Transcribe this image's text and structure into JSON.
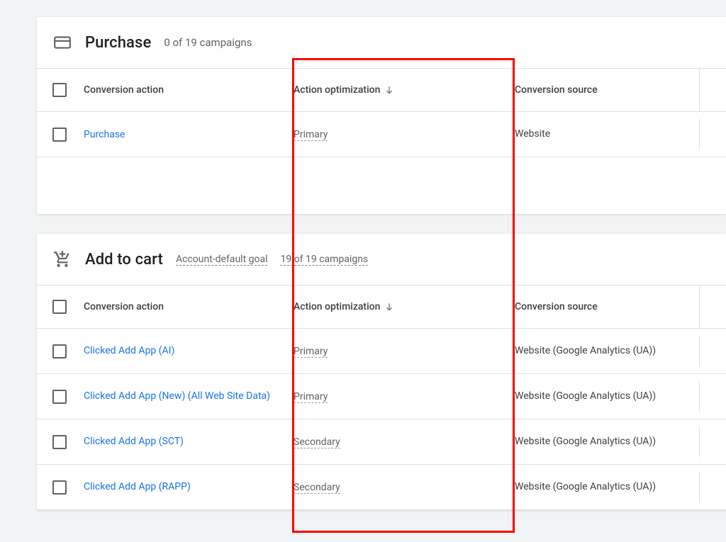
{
  "columns": {
    "action": "Conversion action",
    "optimization": "Action optimization",
    "source": "Conversion source"
  },
  "sections": [
    {
      "icon": "credit-card",
      "title": "Purchase",
      "badges": [
        "0 of 19 campaigns"
      ],
      "rows": [
        {
          "name": "Purchase",
          "optimization": "Primary",
          "source": "Website"
        }
      ],
      "hasSpacer": true
    },
    {
      "icon": "add-to-cart",
      "title": "Add to cart",
      "badges": [
        "Account-default goal",
        "19 of 19 campaigns"
      ],
      "rows": [
        {
          "name": "Clicked Add App (AI)",
          "optimization": "Primary",
          "source": "Website (Google Analytics (UA))"
        },
        {
          "name": "Clicked Add App (New) (All Web Site Data)",
          "optimization": "Primary",
          "source": "Website (Google Analytics (UA))"
        },
        {
          "name": "Clicked Add App (SCT)",
          "optimization": "Secondary",
          "source": "Website (Google Analytics (UA))"
        },
        {
          "name": "Clicked Add App (RAPP)",
          "optimization": "Secondary",
          "source": "Website (Google Analytics (UA))"
        }
      ],
      "hasSpacer": false
    }
  ]
}
